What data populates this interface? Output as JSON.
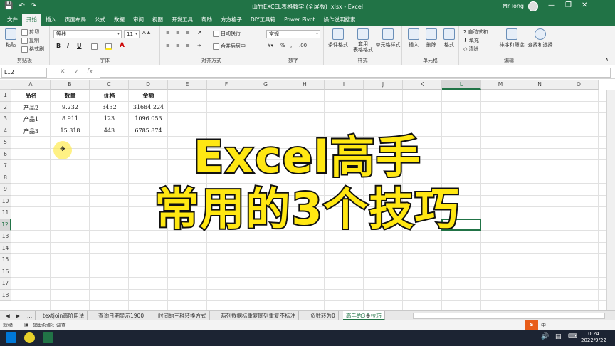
{
  "window": {
    "title": "山竹EXCEL表格教学 (全屏版) .xlsx - Excel",
    "user": "Mr long",
    "buttons": [
      "—",
      "❐",
      "✕"
    ]
  },
  "qat": [
    "💾",
    "↶",
    "↷"
  ],
  "tabs": [
    "文件",
    "开始",
    "插入",
    "页面布局",
    "公式",
    "数据",
    "审阅",
    "视图",
    "开发工具",
    "帮助",
    "方方格子",
    "DIY工具箱",
    "Power Pivot",
    "操作说明搜索"
  ],
  "active_tab": "开始",
  "ribbon": {
    "clipboard": {
      "label": "剪贴板",
      "paste": "粘贴",
      "cut": "剪切",
      "copy": "复制",
      "format_painter": "格式刷"
    },
    "font": {
      "label": "字体",
      "font_name": "等线",
      "font_size": "11",
      "bold": "B",
      "italic": "I",
      "underline": "U"
    },
    "alignment": {
      "label": "对齐方式",
      "wrap": "自动换行",
      "merge": "合并后居中"
    },
    "number": {
      "label": "数字",
      "format": "常规"
    },
    "styles": {
      "label": "样式",
      "conditional": "条件格式",
      "table": "套用\n表格格式",
      "cell_styles": "单元格样式"
    },
    "cells": {
      "label": "单元格",
      "insert": "插入",
      "delete": "删除",
      "format": "格式"
    },
    "editing": {
      "label": "编辑",
      "autosum": "自动求和",
      "fill": "填充",
      "clear": "清除",
      "sort": "排序和筛选",
      "find": "查找和选择"
    }
  },
  "formula_bar": {
    "name_box": "L12",
    "fx": "fx",
    "value": ""
  },
  "columns": [
    "A",
    "B",
    "C",
    "D",
    "E",
    "F",
    "G",
    "H",
    "I",
    "J",
    "K",
    "L",
    "M",
    "N",
    "O"
  ],
  "rows": [
    "1",
    "2",
    "3",
    "4",
    "5",
    "6",
    "7",
    "8",
    "9",
    "10",
    "11",
    "12",
    "13",
    "14",
    "15",
    "16",
    "17",
    "18"
  ],
  "selected_cell": "L12",
  "table": {
    "headers": [
      "品名",
      "数量",
      "价格",
      "金额"
    ],
    "rows": [
      [
        "产品2",
        "9.232",
        "3432",
        "31684.224"
      ],
      [
        "产品1",
        "8.911",
        "123",
        "1096.053"
      ],
      [
        "产品3",
        "15.318",
        "443",
        "6785.874"
      ]
    ]
  },
  "caption": {
    "line1": "Excel高手",
    "line2": "常用的3个技巧"
  },
  "sheet_tabs": [
    "...",
    "textjoin高阶用法",
    "查询日期显示1900",
    "时间的三种转换方式",
    "两列数据标重复同列重复不标注",
    "负数转为0",
    "高手的3个技巧"
  ],
  "active_sheet": "高手的3个技巧",
  "status": {
    "ready": "就绪",
    "accessibility": "辅助功能: 调查"
  },
  "taskbar": {
    "time": "0:24",
    "date": "2022/9/22",
    "ime": "中"
  }
}
